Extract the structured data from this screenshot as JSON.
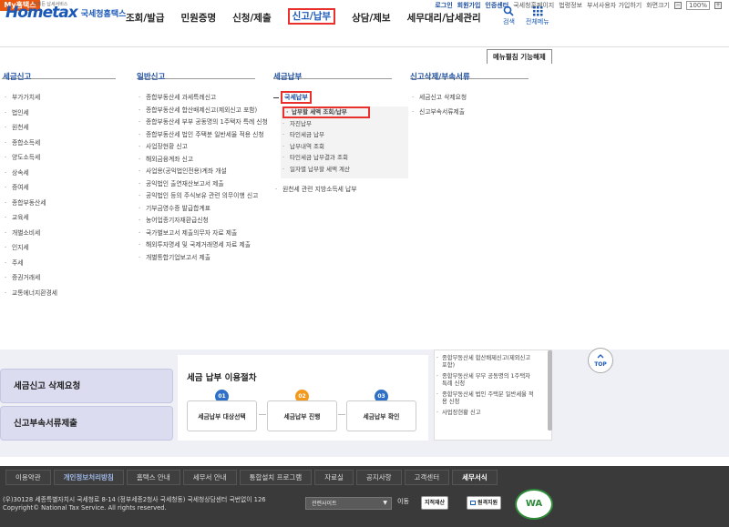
{
  "topbar": {
    "myhome": "My홈택스",
    "links": [
      "로그인",
      "회원가입",
      "인증센터",
      "국세청홈페이지",
      "법령정보",
      "부서사용자 가입하기",
      "화면크기"
    ],
    "zoom_minus": "−",
    "zoom_value": "100%",
    "zoom_plus": "+"
  },
  "header": {
    "logo": "Hometax",
    "logo_sub": "국세청홈택스",
    "logo_tiny": "언제든 납세서비스",
    "nav": [
      "조회/발급",
      "민원증명",
      "신청/제출",
      "신고/납부",
      "상담/제보",
      "세무대리/납세관리"
    ],
    "search_label": "검색",
    "allmenu_label": "전체메뉴"
  },
  "menu_off_label": "메뉴펼침 기능해제",
  "mega": {
    "col1": {
      "title": "세금신고",
      "items": [
        "부가가치세",
        "법인세",
        "원천세",
        "종합소득세",
        "양도소득세",
        "상속세",
        "증여세",
        "종합부동산세",
        "교육세",
        "개별소비세",
        "인지세",
        "주세",
        "증권거래세",
        "교통에너지환경세"
      ]
    },
    "col2": {
      "title": "일반신고",
      "items": [
        "종합부동산세 과세특례신고",
        "종합부동산세 합산배제신고(제외신고 포함)",
        "종합부동산세 부부 공동명의 1주택자 특례 신청",
        "종합부동산세 법인 주택분 일반세율 적용 신청",
        "사업장현황 신고",
        "해외금융계좌 신고",
        "사업용(공익법인전용)계좌 개설",
        "공익법인 출연재산보고서 제출",
        "공익법인 등의 주식보유 관련 의무이행 신고",
        "기부금영수증 발급합계표",
        "농어업종기자재환급신청",
        "국가별보고서 제출의무자 자료 제출",
        "해외투자명세 및 국제거래명세 자료 제출",
        "개별통합기업보고서 제출"
      ]
    },
    "col3": {
      "title": "세금납부",
      "group_label": "국세납부",
      "sub_items": [
        "납부할 세액 조회/납부",
        "자진납부",
        "타인세금 납부",
        "납부내역 조회",
        "타인세금 납부결과 조회",
        "일자별 납부할 세액 계산"
      ],
      "extra": "원천세 관련 지방소득세 납부"
    },
    "col4": {
      "title": "신고삭제/부속서류",
      "items": [
        "세금신고 삭제요청",
        "신고부속서류제출"
      ]
    }
  },
  "lower": {
    "btn_delete": "세금신고 삭제요청",
    "btn_docs": "신고부속서류제출",
    "proc_title": "세금 납부 이용절차",
    "steps": [
      {
        "num": "01",
        "label": "세금납부 대상선택",
        "color": "#2e6fc7"
      },
      {
        "num": "02",
        "label": "세금납부 진행",
        "color": "#f39a1e"
      },
      {
        "num": "03",
        "label": "세금납부 확인",
        "color": "#2e6fc7"
      }
    ],
    "scroll_items": [
      "종합부동산세 합산배제신고(제외신고 포함)",
      "종합부동산세 부부 공동명의 1주택자 특례 신청",
      "종합부동산세 법인 주택분 일반세율 적용 신청",
      "사업장현황 신고"
    ],
    "top_label": "TOP"
  },
  "footer": {
    "links": [
      "이용약관",
      "개인정보처리방침",
      "홈택스 안내",
      "세무서 안내",
      "통합설치 프로그램",
      "자료실",
      "공지사항",
      "고객센터",
      "세무서식"
    ],
    "addr1": "(우)30128 세종특별자치시 국세청로 8-14 (정부세종2청사 국세청동) 국세청상담센터 국번없이 126",
    "addr2": "Copyright© National Tax Service. All rights reserved.",
    "related": "관련사이트",
    "go": "이동",
    "btn1": "지적재산",
    "btn2": "원격지원",
    "wa": "WA"
  }
}
